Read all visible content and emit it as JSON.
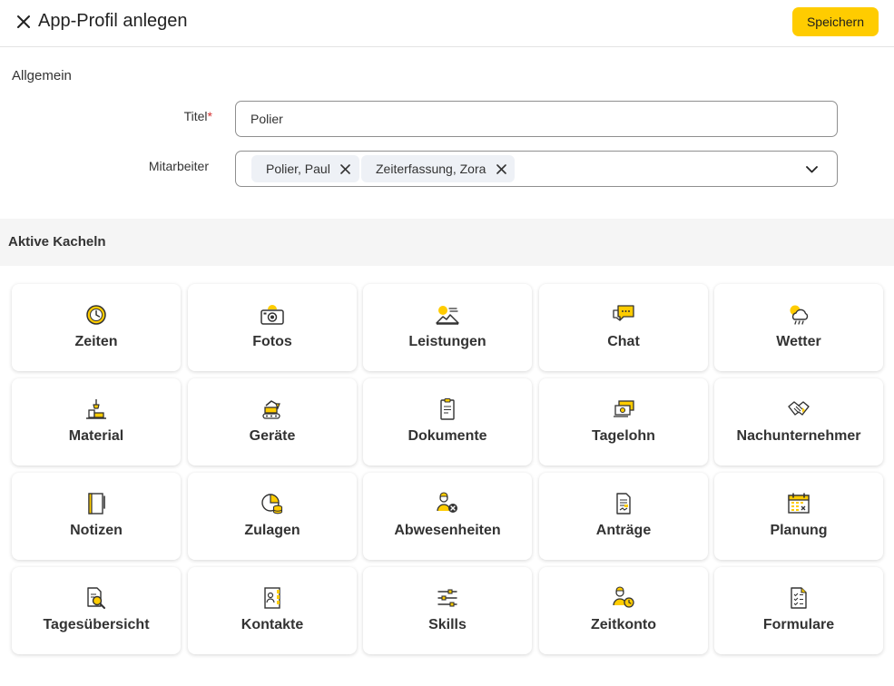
{
  "header": {
    "title": "App-Profil anlegen",
    "save_label": "Speichern",
    "close_icon": "close-icon"
  },
  "general": {
    "heading": "Allgemein",
    "title_label": "Titel",
    "title_required_mark": "*",
    "title_value": "Polier",
    "employees_label": "Mitarbeiter",
    "employees": [
      "Polier, Paul",
      "Zeiterfassung, Zora"
    ]
  },
  "tiles_section": {
    "heading": "Aktive Kacheln",
    "tiles": [
      {
        "label": "Zeiten",
        "icon": "clock-icon"
      },
      {
        "label": "Fotos",
        "icon": "camera-icon"
      },
      {
        "label": "Leistungen",
        "icon": "landscape-sun-icon"
      },
      {
        "label": "Chat",
        "icon": "chat-bubbles-icon"
      },
      {
        "label": "Wetter",
        "icon": "weather-cloud-icon"
      },
      {
        "label": "Material",
        "icon": "material-stack-icon"
      },
      {
        "label": "Geräte",
        "icon": "excavator-icon"
      },
      {
        "label": "Dokumente",
        "icon": "document-clipboard-icon"
      },
      {
        "label": "Tagelohn",
        "icon": "money-bills-icon"
      },
      {
        "label": "Nachunternehmer",
        "icon": "handshake-icon"
      },
      {
        "label": "Notizen",
        "icon": "notebook-icon"
      },
      {
        "label": "Zulagen",
        "icon": "pie-coins-icon"
      },
      {
        "label": "Abwesenheiten",
        "icon": "person-absent-icon"
      },
      {
        "label": "Anträge",
        "icon": "request-form-icon"
      },
      {
        "label": "Planung",
        "icon": "calendar-icon"
      },
      {
        "label": "Tagesübersicht",
        "icon": "document-search-icon"
      },
      {
        "label": "Kontakte",
        "icon": "contacts-book-icon"
      },
      {
        "label": "Skills",
        "icon": "sliders-icon"
      },
      {
        "label": "Zeitkonto",
        "icon": "person-clock-icon"
      },
      {
        "label": "Formulare",
        "icon": "checklist-form-icon"
      }
    ]
  },
  "colors": {
    "accent": "#ffcc00",
    "section_band": "#f5f5f5",
    "chip_bg": "#eef1f6",
    "required": "#d32f2f",
    "icon_stroke": "#333333"
  }
}
